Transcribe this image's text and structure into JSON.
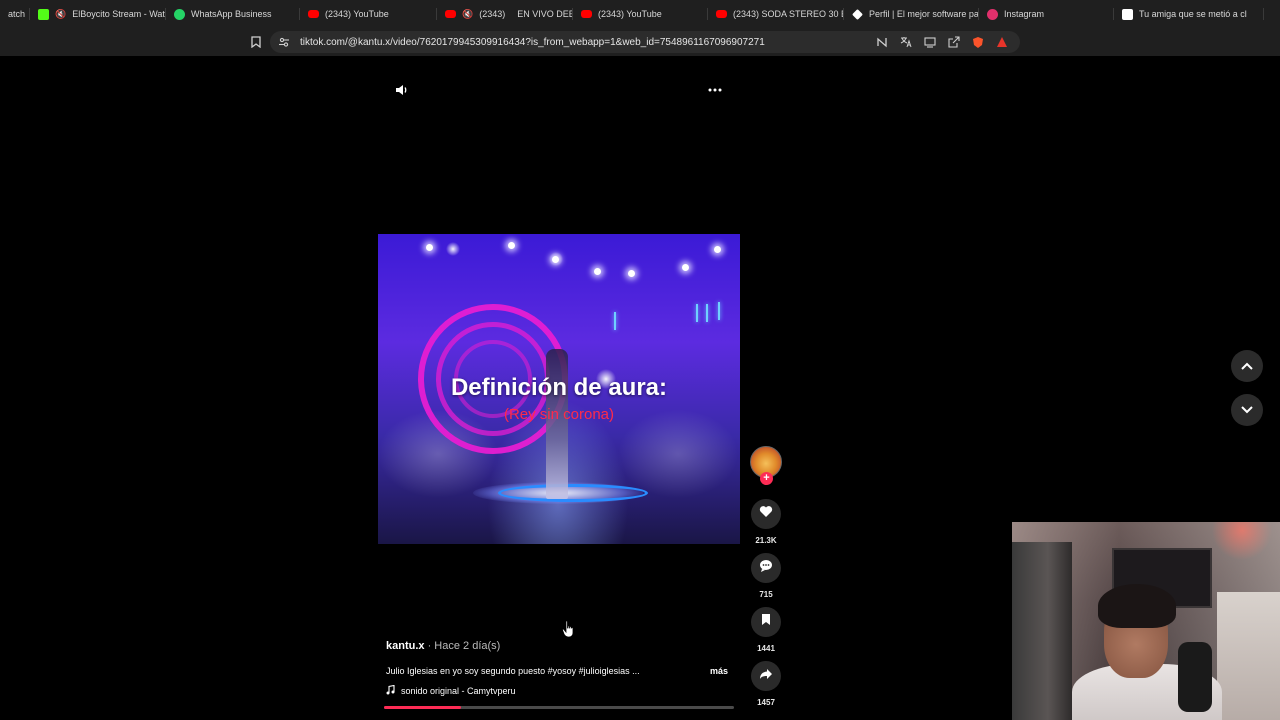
{
  "browser": {
    "tabs": [
      {
        "label": "atch",
        "favicon": "tab-icon",
        "color": "#888888",
        "muted": false
      },
      {
        "label": "ElBoycito Stream - Wat",
        "favicon": "kick-icon",
        "color": "#53fc18",
        "muted": true
      },
      {
        "label": "WhatsApp Business",
        "favicon": "whatsapp-icon",
        "color": "#25d366",
        "muted": false
      },
      {
        "label": "(2343) YouTube",
        "favicon": "youtube-icon",
        "color": "#ff0000",
        "muted": false
      },
      {
        "label": "(2343) ",
        "label2": "EN VIVO DEB",
        "favicon": "youtube-icon",
        "color": "#ff0000",
        "muted": true,
        "live": true
      },
      {
        "label": "(2343) YouTube",
        "favicon": "youtube-icon",
        "color": "#ff0000",
        "muted": false
      },
      {
        "label": "(2343) SODA STEREO 30 ÉX",
        "favicon": "youtube-icon",
        "color": "#ff0000",
        "muted": false
      },
      {
        "label": "Perfil | El mejor software pa",
        "favicon": "diamond-icon",
        "color": "#ffffff",
        "muted": false
      },
      {
        "label": "Instagram",
        "favicon": "instagram-icon",
        "color": "#e1306c",
        "muted": false
      },
      {
        "label": "Tu amiga que se metió a cl",
        "favicon": "tiktok-icon",
        "color": "#ffffff",
        "muted": false
      }
    ],
    "url": "tiktok.com/@kantu.x/video/7620179945309916434?is_from_webapp=1&web_id=7548961167096907271"
  },
  "video": {
    "title": "Definición de aura:",
    "subtitle": "(Rey sin corona)",
    "progress_fraction": 0.22
  },
  "post": {
    "author": "kantu.x",
    "separator": " · ",
    "time_ago": "Hace 2 día(s)",
    "description": "Julio Iglesias en yo soy segundo puesto #yosoy #julioiglesias ...",
    "more": "más",
    "sound": "sonido original - Camytvperu"
  },
  "actions": {
    "follow_plus": "+",
    "likes": "21.3K",
    "comments": "715",
    "saves": "1441",
    "shares": "1457"
  },
  "colors": {
    "accent": "#fe2c55"
  }
}
